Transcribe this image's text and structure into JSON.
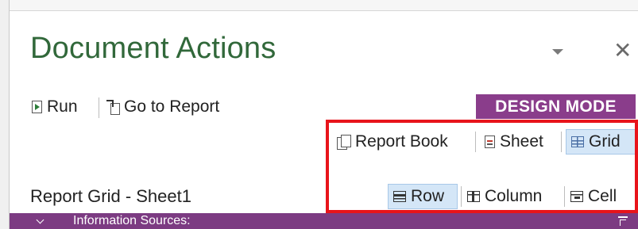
{
  "pane": {
    "title": "Document Actions",
    "dropdown_icon": "chevron-down-icon",
    "close_glyph": "✕"
  },
  "toolbar": {
    "run_label": "Run",
    "goto_label": "Go to Report",
    "design_mode_badge": "DESIGN MODE"
  },
  "views": {
    "report_book_label": "Report Book",
    "sheet_label": "Sheet",
    "grid_label": "Grid",
    "row_label": "Row",
    "column_label": "Column",
    "cell_label": "Cell",
    "active_items": [
      "Grid",
      "Row"
    ]
  },
  "context": {
    "title": "Report Grid - Sheet1"
  },
  "information_sources": {
    "label": "Information Sources:"
  },
  "colors": {
    "title_green": "#31683a",
    "design_mode_purple": "#8a3d8b",
    "info_bar_purple": "#7c3b82",
    "highlight_red": "#e8141b",
    "active_blue": "#d4e6f7"
  }
}
